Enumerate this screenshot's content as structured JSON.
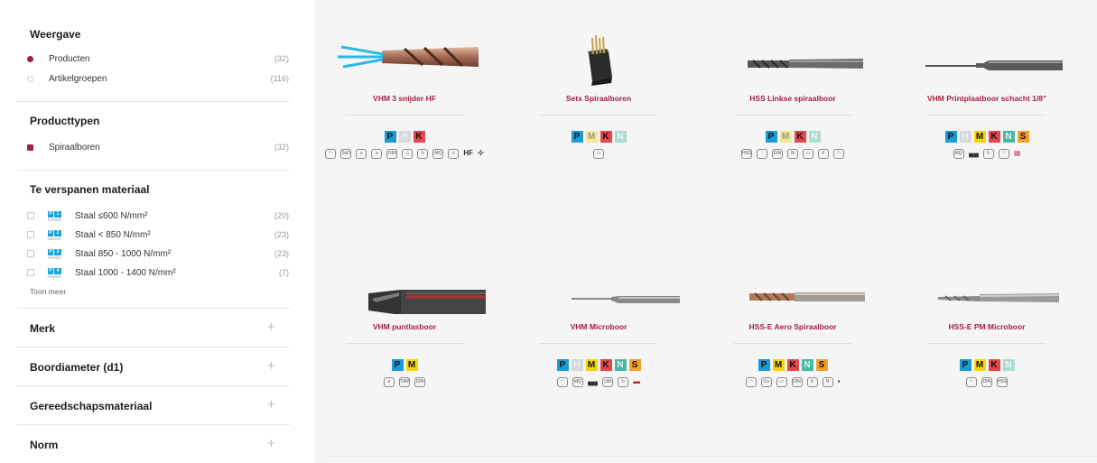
{
  "sidebar": {
    "weergave": {
      "title": "Weergave",
      "options": [
        {
          "label": "Producten",
          "count": "(32)",
          "selected": true
        },
        {
          "label": "Artikelgroepen",
          "count": "(116)",
          "selected": false
        }
      ]
    },
    "producttypen": {
      "title": "Producttypen",
      "options": [
        {
          "label": "Spiraalboren",
          "count": "(32)",
          "selected": true
        }
      ]
    },
    "materiaal": {
      "title": "Te verspanen materiaal",
      "options": [
        {
          "label": "Staal ≤600 N/mm²",
          "count": "(20)"
        },
        {
          "label": "Staal < 850 N/mm²",
          "count": "(23)"
        },
        {
          "label": "Staal 850 - 1000 N/mm²",
          "count": "(23)"
        },
        {
          "label": "Staal 1000 - 1400 N/mm²",
          "count": "(7)"
        }
      ],
      "more_label": "Toon meer"
    },
    "collapsed": [
      {
        "label": "Merk",
        "icon": "plus-icon"
      },
      {
        "label": "Boordiameter (d1)",
        "icon": "plus-icon"
      },
      {
        "label": "Gereedschapsmateriaal",
        "icon": "plus-icon"
      },
      {
        "label": "Norm",
        "icon": "plus-icon"
      }
    ],
    "plus_glyph": "+"
  },
  "products": [
    {
      "title": "VHM 3 snijder HF",
      "image": "coated-drill-with-coolant-icon",
      "badges": [
        [
          "P",
          "on"
        ],
        [
          "H",
          "dim"
        ],
        [
          "K",
          "on"
        ]
      ],
      "icons": [
        "spiral",
        "5xD",
        "int",
        "ext",
        "DIN",
        "bar",
        "rot",
        "MQ",
        "sym",
        "HF",
        "fan"
      ]
    },
    {
      "title": "Sets Spiraalboren",
      "image": "drill-set-box-icon",
      "badges": [
        [
          "P",
          "on"
        ],
        [
          "M",
          "dim"
        ],
        [
          "K",
          "on"
        ],
        [
          "N",
          "dim"
        ]
      ],
      "icons": [
        "case"
      ]
    },
    {
      "title": "HSS Linkse spiraalboor",
      "image": "left-hand-drill-icon",
      "badges": [
        [
          "P",
          "on"
        ],
        [
          "M",
          "dim"
        ],
        [
          "K",
          "on"
        ],
        [
          "N",
          "dim"
        ]
      ],
      "icons": [
        "HSS",
        "tip",
        "DIN",
        "N",
        "case",
        "F",
        "spiral"
      ]
    },
    {
      "title": "VHM Printplaatboor schacht 1/8\"",
      "image": "pcb-drill-icon",
      "badges": [
        [
          "P",
          "on"
        ],
        [
          "H",
          "dim"
        ],
        [
          "M",
          "on"
        ],
        [
          "K",
          "on"
        ],
        [
          "N",
          "on"
        ],
        [
          "S",
          "on"
        ]
      ],
      "icons": [
        "MQ",
        "pkg",
        "rot",
        "spiral",
        "grid"
      ]
    },
    {
      "title": "VHM puntlasboor",
      "image": "spot-weld-drill-icon",
      "badges": [
        [
          "P",
          "on"
        ],
        [
          "M",
          "on"
        ]
      ],
      "icons": [
        "int",
        "TiAlN",
        "DIN"
      ]
    },
    {
      "title": "VHM Microboor",
      "image": "micro-drill-icon",
      "badges": [
        [
          "P",
          "on"
        ],
        [
          "H",
          "dim"
        ],
        [
          "M",
          "on"
        ],
        [
          "K",
          "on"
        ],
        [
          "N",
          "on"
        ],
        [
          "S",
          "on"
        ]
      ],
      "icons": [
        "spiral",
        "MQ",
        "pkg",
        "UM",
        "rot",
        "bar"
      ]
    },
    {
      "title": "HSS-E Aero Spiraalboor",
      "image": "aero-drill-icon",
      "badges": [
        [
          "P",
          "on"
        ],
        [
          "M",
          "on"
        ],
        [
          "K",
          "on"
        ],
        [
          "N",
          "on"
        ],
        [
          "S",
          "on"
        ]
      ],
      "icons": [
        "spiral",
        "Co",
        "case",
        "DIN",
        "rot",
        "N",
        "kit"
      ]
    },
    {
      "title": "HSS-E PM Microboor",
      "image": "pm-micro-drill-icon",
      "badges": [
        [
          "P",
          "on"
        ],
        [
          "M",
          "on"
        ],
        [
          "K",
          "on"
        ],
        [
          "N",
          "dim"
        ]
      ],
      "icons": [
        "spiral",
        "DIN",
        "HSS"
      ]
    }
  ]
}
